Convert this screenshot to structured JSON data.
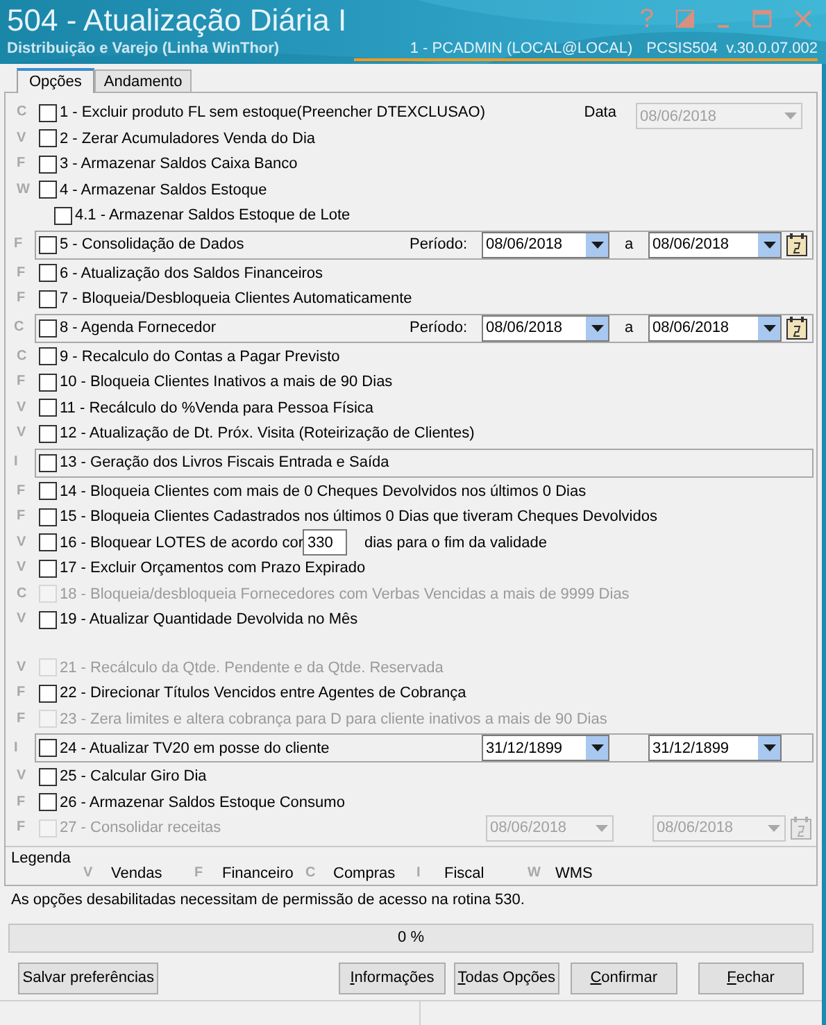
{
  "window": {
    "title": "504 - Atualização Diária I",
    "subtitle": "Distribuição e Varejo (Linha WinThor)",
    "user": "1 - PCADMIN (LOCAL@LOCAL)",
    "program": "PCSIS504",
    "version": "v.30.0.07.002"
  },
  "tabs": [
    {
      "label": "Opções",
      "selected": true
    },
    {
      "label": "Andamento",
      "selected": false
    }
  ],
  "data_field": {
    "label": "Data",
    "value": "08/06/2018",
    "disabled": true
  },
  "options": [
    {
      "category": "C",
      "label": "1 - Excluir produto FL sem estoque(Preencher DTEXCLUSAO)",
      "checked": false,
      "disabled": false,
      "framed": false
    },
    {
      "category": "V",
      "label": "2 - Zerar Acumuladores Venda do Dia",
      "checked": false,
      "disabled": false,
      "framed": false
    },
    {
      "category": "F",
      "label": "3 - Armazenar Saldos Caixa Banco",
      "checked": false,
      "disabled": false,
      "framed": false
    },
    {
      "category": "W",
      "label": "4 - Armazenar Saldos Estoque",
      "checked": false,
      "disabled": false,
      "framed": false,
      "children": [
        {
          "label": "4.1 - Armazenar Saldos Estoque de Lote",
          "checked": false,
          "disabled": false
        }
      ]
    },
    {
      "category": "F",
      "label": "5 - Consolidação de Dados",
      "checked": false,
      "disabled": false,
      "framed": true,
      "period_label": "Período:",
      "separator": "a",
      "dates": [
        {
          "value": "08/06/2018",
          "disabled": false
        },
        {
          "value": "08/06/2018",
          "disabled": false
        }
      ],
      "calendar": true
    },
    {
      "category": "F",
      "label": "6 - Atualização dos Saldos Financeiros",
      "checked": false,
      "disabled": false,
      "framed": false
    },
    {
      "category": "F",
      "label": "7 - Bloqueia/Desbloqueia Clientes Automaticamente",
      "checked": false,
      "disabled": false,
      "framed": false
    },
    {
      "category": "C",
      "label": "8 - Agenda Fornecedor",
      "checked": false,
      "disabled": false,
      "framed": true,
      "period_label": "Período:",
      "separator": "a",
      "dates": [
        {
          "value": "08/06/2018",
          "disabled": false
        },
        {
          "value": "08/06/2018",
          "disabled": false
        }
      ],
      "calendar": true
    },
    {
      "category": "C",
      "label": "9 - Recalculo do Contas a Pagar Previsto",
      "checked": false,
      "disabled": false,
      "framed": false
    },
    {
      "category": "F",
      "label": "10 - Bloqueia Clientes Inativos a mais de 90 Dias",
      "checked": false,
      "disabled": false,
      "framed": false
    },
    {
      "category": "V",
      "label": "11 - Recálculo do %Venda para Pessoa Física",
      "checked": false,
      "disabled": false,
      "framed": false
    },
    {
      "category": "V",
      "label": "12 - Atualização de Dt. Próx. Visita (Roteirização de Clientes)",
      "checked": false,
      "disabled": false,
      "framed": false
    },
    {
      "category": "I",
      "label": "13 - Geração dos Livros Fiscais Entrada e Saída",
      "checked": false,
      "disabled": false,
      "framed": true
    },
    {
      "category": "F",
      "label": "14 - Bloqueia Clientes com mais de 0 Cheques Devolvidos nos últimos 0  Dias",
      "checked": false,
      "disabled": false,
      "framed": false
    },
    {
      "category": "F",
      "label": "15 - Bloqueia Clientes Cadastrados nos últimos 0 Dias que tiveram Cheques Devolvidos",
      "checked": false,
      "disabled": false,
      "framed": false
    },
    {
      "category": "V",
      "label": "16 - Bloquear LOTES de acordo cor",
      "checked": false,
      "disabled": false,
      "framed": false,
      "input": "330",
      "suffix": "dias para o fim da validade"
    },
    {
      "category": "V",
      "label": "17 - Excluir Orçamentos com Prazo Expirado",
      "checked": false,
      "disabled": false,
      "framed": false
    },
    {
      "category": "C",
      "label": "18 - Bloqueia/desbloqueia Fornecedores com Verbas Vencidas a mais de 9999 Dias",
      "checked": false,
      "disabled": true,
      "framed": false
    },
    {
      "category": "V",
      "label": "19 - Atualizar Quantidade Devolvida no Mês",
      "checked": false,
      "disabled": false,
      "framed": false
    },
    {
      "category": "V",
      "label": "21 - Recálculo da Qtde. Pendente e da Qtde. Reservada",
      "checked": false,
      "disabled": true,
      "framed": false,
      "gap_before": true
    },
    {
      "category": "F",
      "label": "22 - Direcionar Títulos Vencidos entre Agentes de Cobrança",
      "checked": false,
      "disabled": false,
      "framed": false
    },
    {
      "category": "F",
      "label": "23 - Zera limites e altera cobrança para D  para cliente inativos a mais de 90 Dias",
      "checked": false,
      "disabled": true,
      "framed": false
    },
    {
      "category": "I",
      "label": "24 - Atualizar TV20 em posse do cliente",
      "checked": false,
      "disabled": false,
      "framed": true,
      "dates": [
        {
          "value": "31/12/1899",
          "disabled": false
        },
        {
          "value": "31/12/1899",
          "disabled": false
        }
      ]
    },
    {
      "category": "V",
      "label": "25 - Calcular Giro Dia",
      "checked": false,
      "disabled": false,
      "framed": false
    },
    {
      "category": "F",
      "label": "26 - Armazenar Saldos Estoque Consumo",
      "checked": false,
      "disabled": false,
      "framed": false
    },
    {
      "category": "F",
      "label": "27 - Consolidar receitas",
      "checked": false,
      "disabled": true,
      "framed": false,
      "dates": [
        {
          "value": "08/06/2018",
          "disabled": true
        },
        {
          "value": "08/06/2018",
          "disabled": true
        }
      ],
      "calendar": true
    }
  ],
  "legend": {
    "title": "Legenda",
    "items": [
      {
        "letter": "V",
        "label": "Vendas"
      },
      {
        "letter": "F",
        "label": "Financeiro"
      },
      {
        "letter": "C",
        "label": "Compras"
      },
      {
        "letter": "I",
        "label": "Fiscal"
      },
      {
        "letter": "W",
        "label": "WMS"
      }
    ]
  },
  "message": "As opções desabilitadas necessitam de permissão de acesso na rotina 530.",
  "progress": {
    "label": "0 %",
    "level": 0
  },
  "buttons": [
    {
      "label": "Salvar preferências",
      "mnemonic": false
    },
    {
      "label": "Informações",
      "mnemonic": true
    },
    {
      "label": "Todas Opções",
      "mnemonic": true
    },
    {
      "label": "Confirmar",
      "mnemonic": true
    },
    {
      "label": "Fechar",
      "mnemonic": true
    }
  ]
}
